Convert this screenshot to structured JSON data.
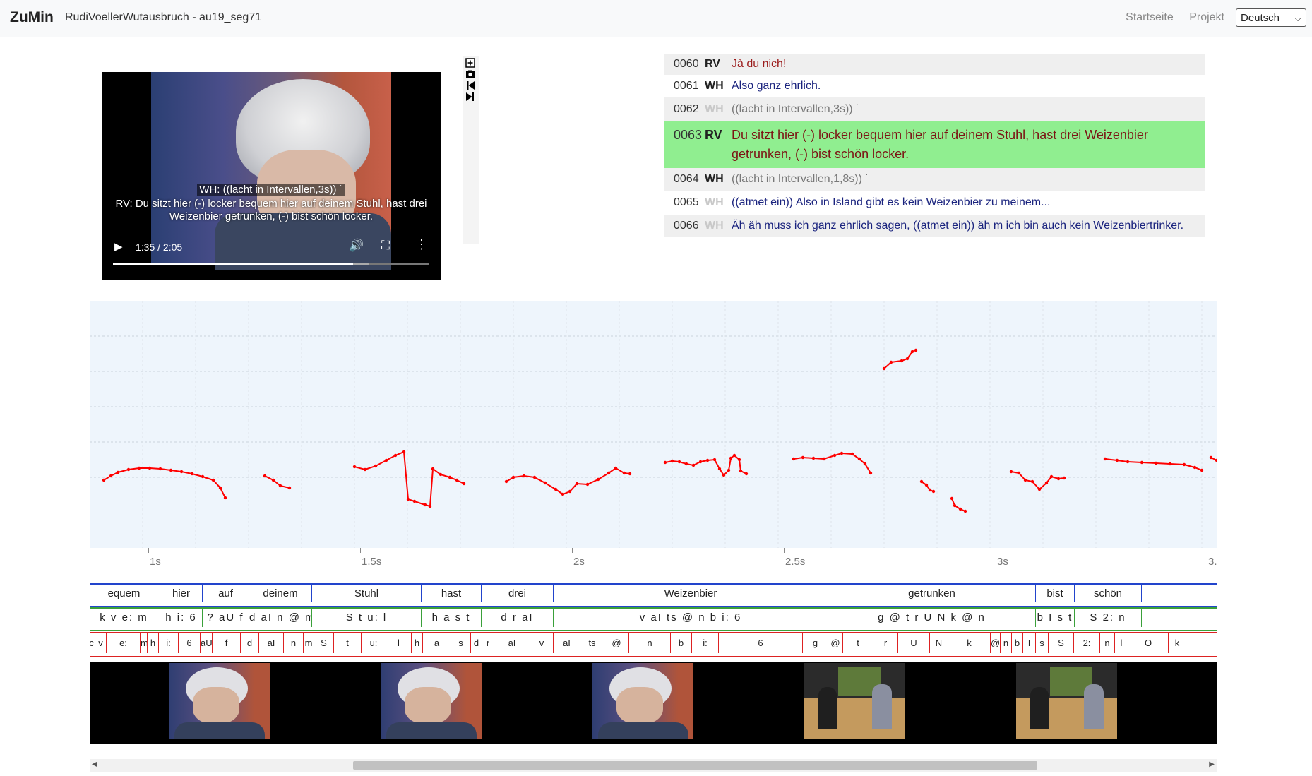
{
  "header": {
    "brand": "ZuMin",
    "title": "RudiVoellerWutausbruch - au19_seg71",
    "links": [
      "Startseite",
      "Projekt"
    ],
    "language": "Deutsch",
    "bg": "#f8f9fa"
  },
  "video": {
    "subtitle_line1": "WH: ((lacht in Intervallen,3s)) ˙",
    "subtitle_line2": "RV: Du sitzt hier (-) locker bequem hier auf deinem Stuhl, hast drei",
    "subtitle_line3": "Weizenbier getrunken, (-) bist schön locker.",
    "time": "1:35 / 2:05",
    "progress": 0.76,
    "buffered_to": 0.81
  },
  "toolbox": {
    "icons": [
      "zoom-in-icon",
      "screenshot-icon",
      "skip-back-icon",
      "skip-forward-icon"
    ]
  },
  "transcript": {
    "active_bg": "#90ee90",
    "lines": [
      {
        "num": "0060",
        "spk": "RV",
        "text": "Jà du nich!",
        "color": "#9b1c1c",
        "spk_gray": false
      },
      {
        "num": "0061",
        "spk": "WH",
        "text": "Also ganz ehrlich.",
        "color": "#1a237e",
        "spk_gray": false
      },
      {
        "num": "0062",
        "spk": "WH",
        "text": "((lacht in Intervallen,3s)) ˙",
        "color": "#777777",
        "spk_gray": true
      },
      {
        "num": "0063",
        "spk": "RV",
        "text": "Du sitzt hier (-) locker bequem hier auf deinem Stuhl, hast drei Weizenbier getrunken, (-) bist schön locker.",
        "color": "#7b1414",
        "spk_gray": false,
        "active": true
      },
      {
        "num": "0064",
        "spk": "WH",
        "text": "((lacht in Intervallen,1,8s)) ˙",
        "color": "#777777",
        "spk_gray": false
      },
      {
        "num": "0065",
        "spk": "WH",
        "text": "((atmet ein)) Also in Island gibt es kein Weizenbier zu meinem...",
        "color": "#1a237e",
        "spk_gray": true
      },
      {
        "num": "0066",
        "spk": "WH",
        "text": "Äh äh muss ich ganz ehrlich sagen, ((atmet ein)) äh m ich bin auch kein Weizenbiertrinker.",
        "color": "#1a237e",
        "spk_gray": true
      }
    ]
  },
  "timeline": {
    "ticks": [
      "1s",
      "1.5s",
      "2s",
      "2.5s",
      "3s",
      "3."
    ],
    "pitch_color": "#ff0000"
  },
  "tiers": {
    "words": [
      "equem",
      "hier",
      "auf",
      "deinem",
      "Stuhl",
      "hast",
      "drei",
      "Weizenbier",
      "getrunken",
      "bist",
      "schön",
      ""
    ],
    "syllables": [
      "k v e: m",
      "h i: 6",
      "? aU f",
      "d aI n @ m",
      "S t u: l",
      "h a s t",
      "d r aI",
      "v aI ts @ n b i: 6",
      "g @ t r U N k @ n",
      "b I s t",
      "S 2: n",
      ""
    ],
    "phones": [
      "c",
      "v",
      "e:",
      "m",
      "h",
      "i:",
      "6",
      "aU",
      "f",
      "d",
      "aI",
      "n",
      "m",
      "S",
      "t",
      "u:",
      "l",
      "h",
      "a",
      "s",
      "d",
      "r",
      "aI",
      "v",
      "aI",
      "ts",
      "@",
      "n",
      "b",
      "i:",
      "6",
      "g",
      "@",
      "t",
      "r",
      "U",
      "N",
      "k",
      "@",
      "n",
      "b",
      "I",
      "s",
      "S",
      "2:",
      "n",
      "l",
      "O",
      "k",
      ""
    ]
  },
  "filmstrip": {
    "thumbs": [
      "closeup",
      "closeup",
      "closeup",
      "wide",
      "wide"
    ]
  },
  "scrollbar": {
    "position": 0.228,
    "size": 0.62
  }
}
